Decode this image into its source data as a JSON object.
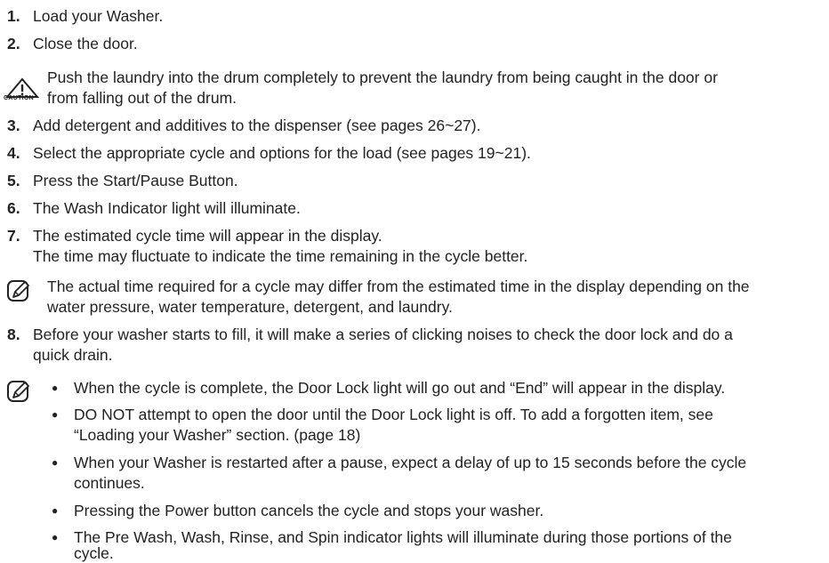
{
  "steps": [
    {
      "num": "1.",
      "text": "Load your Washer."
    },
    {
      "num": "2.",
      "text": "Close the door."
    },
    {
      "num": "3.",
      "text": "Add detergent and additives to the dispenser (see pages 26~27)."
    },
    {
      "num": "4.",
      "text": "Select the appropriate cycle and options for the load (see pages 19~21)."
    },
    {
      "num": "5.",
      "text": "Press the Start/Pause Button."
    },
    {
      "num": "6.",
      "text": "The Wash Indicator light will illuminate."
    },
    {
      "num": "7.",
      "text": "The estimated cycle time will appear in the display.",
      "text2": "The time may fluctuate to indicate the time remaining in the cycle better."
    },
    {
      "num": "8.",
      "text": "Before your washer starts to fill, it will make a series of clicking noises to check the door lock and do a",
      "text2": "quick drain."
    }
  ],
  "caution": {
    "label": "CAUTION",
    "line1": "Push the laundry into the drum completely to prevent the laundry from being caught in the door or",
    "line2": "from falling out of the drum."
  },
  "note1": {
    "line1": "The actual time required for a cycle may differ from the estimated time in the display depending on the",
    "line2": "water pressure, water temperature, detergent, and laundry."
  },
  "note2": {
    "bullets": [
      {
        "line1": "When the cycle is complete, the Door Lock light will go out and “End” will appear in the display."
      },
      {
        "line1": "DO NOT attempt to open the door until the Door Lock light is off. To add a forgotten item, see",
        "line2": "“Loading your Washer” section. (page 18)"
      },
      {
        "line1": "When your Washer is restarted after a pause, expect a delay of up to 15 seconds before the cycle",
        "line2": "continues."
      },
      {
        "line1": "Pressing the Power button cancels the cycle and stops your washer."
      },
      {
        "line1": "The Pre Wash, Wash, Rinse, and Spin indicator lights will illuminate during those portions of the",
        "line2": "cycle."
      }
    ]
  }
}
